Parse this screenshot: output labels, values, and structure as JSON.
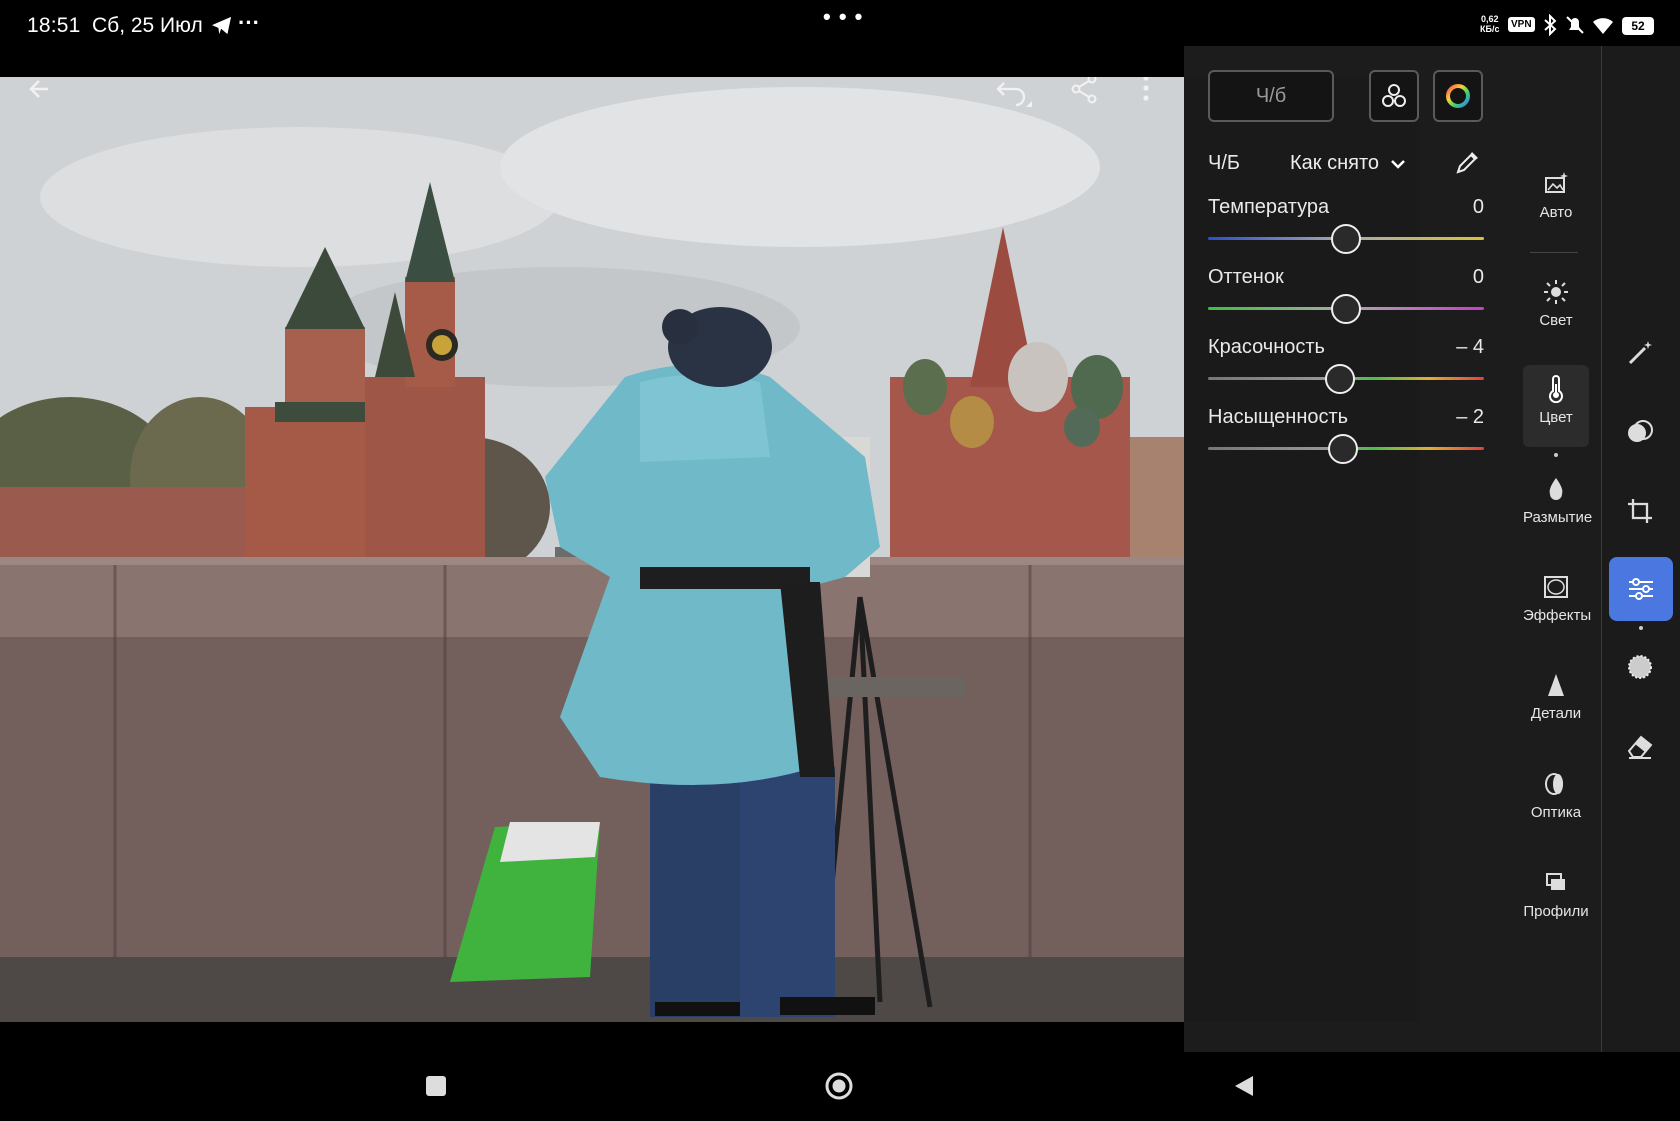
{
  "status_bar": {
    "time": "18:51",
    "date": "Сб, 25 Июл",
    "more": "···",
    "center_dots": "• • •",
    "speed_top": "0,62",
    "speed_bottom": "КБ/с",
    "vpn": "VPN",
    "battery": "52"
  },
  "photo_toolbar": {
    "back_icon": "arrow-left-icon",
    "undo_icon": "undo-icon",
    "share_icon": "share-icon",
    "menu_icon": "more-vertical-icon"
  },
  "color_panel": {
    "mode_button": "Ч/б",
    "mix_icon": "color-mix-icon",
    "grade_icon": "color-grading-icon",
    "bw_label": "Ч/Б",
    "profile": "Как снято",
    "eyedropper_icon": "eyedropper-icon",
    "sliders": [
      {
        "label": "Температура",
        "value": "0",
        "level": 0.5
      },
      {
        "label": "Оттенок",
        "value": "0",
        "level": 0.5
      },
      {
        "label": "Красочность",
        "value": "– 4",
        "level": 0.48
      },
      {
        "label": "Насыщенность",
        "value": "– 2",
        "level": 0.49
      }
    ]
  },
  "tools": [
    {
      "label": "Авто",
      "icon": "auto-icon"
    },
    {
      "label": "Свет",
      "icon": "light-icon"
    },
    {
      "label": "Цвет",
      "icon": "thermometer-icon",
      "active": true
    },
    {
      "label": "Размытие",
      "icon": "blur-drop-icon"
    },
    {
      "label": "Эффекты",
      "icon": "effects-icon"
    },
    {
      "label": "Детали",
      "icon": "detail-triangle-icon"
    },
    {
      "label": "Оптика",
      "icon": "optics-icon"
    },
    {
      "label": "Профили",
      "icon": "profiles-icon"
    }
  ],
  "side_icons": [
    "magic-wand-icon",
    "masking-icon",
    "crop-icon",
    "edit-sliders-icon",
    "selective-icon",
    "eraser-icon"
  ],
  "nav": {
    "recents": "square-icon",
    "home": "circle-icon",
    "back": "triangle-back-icon"
  },
  "colors": {
    "accent": "#4a78e0",
    "panel_bg": "#1e1e1e"
  }
}
